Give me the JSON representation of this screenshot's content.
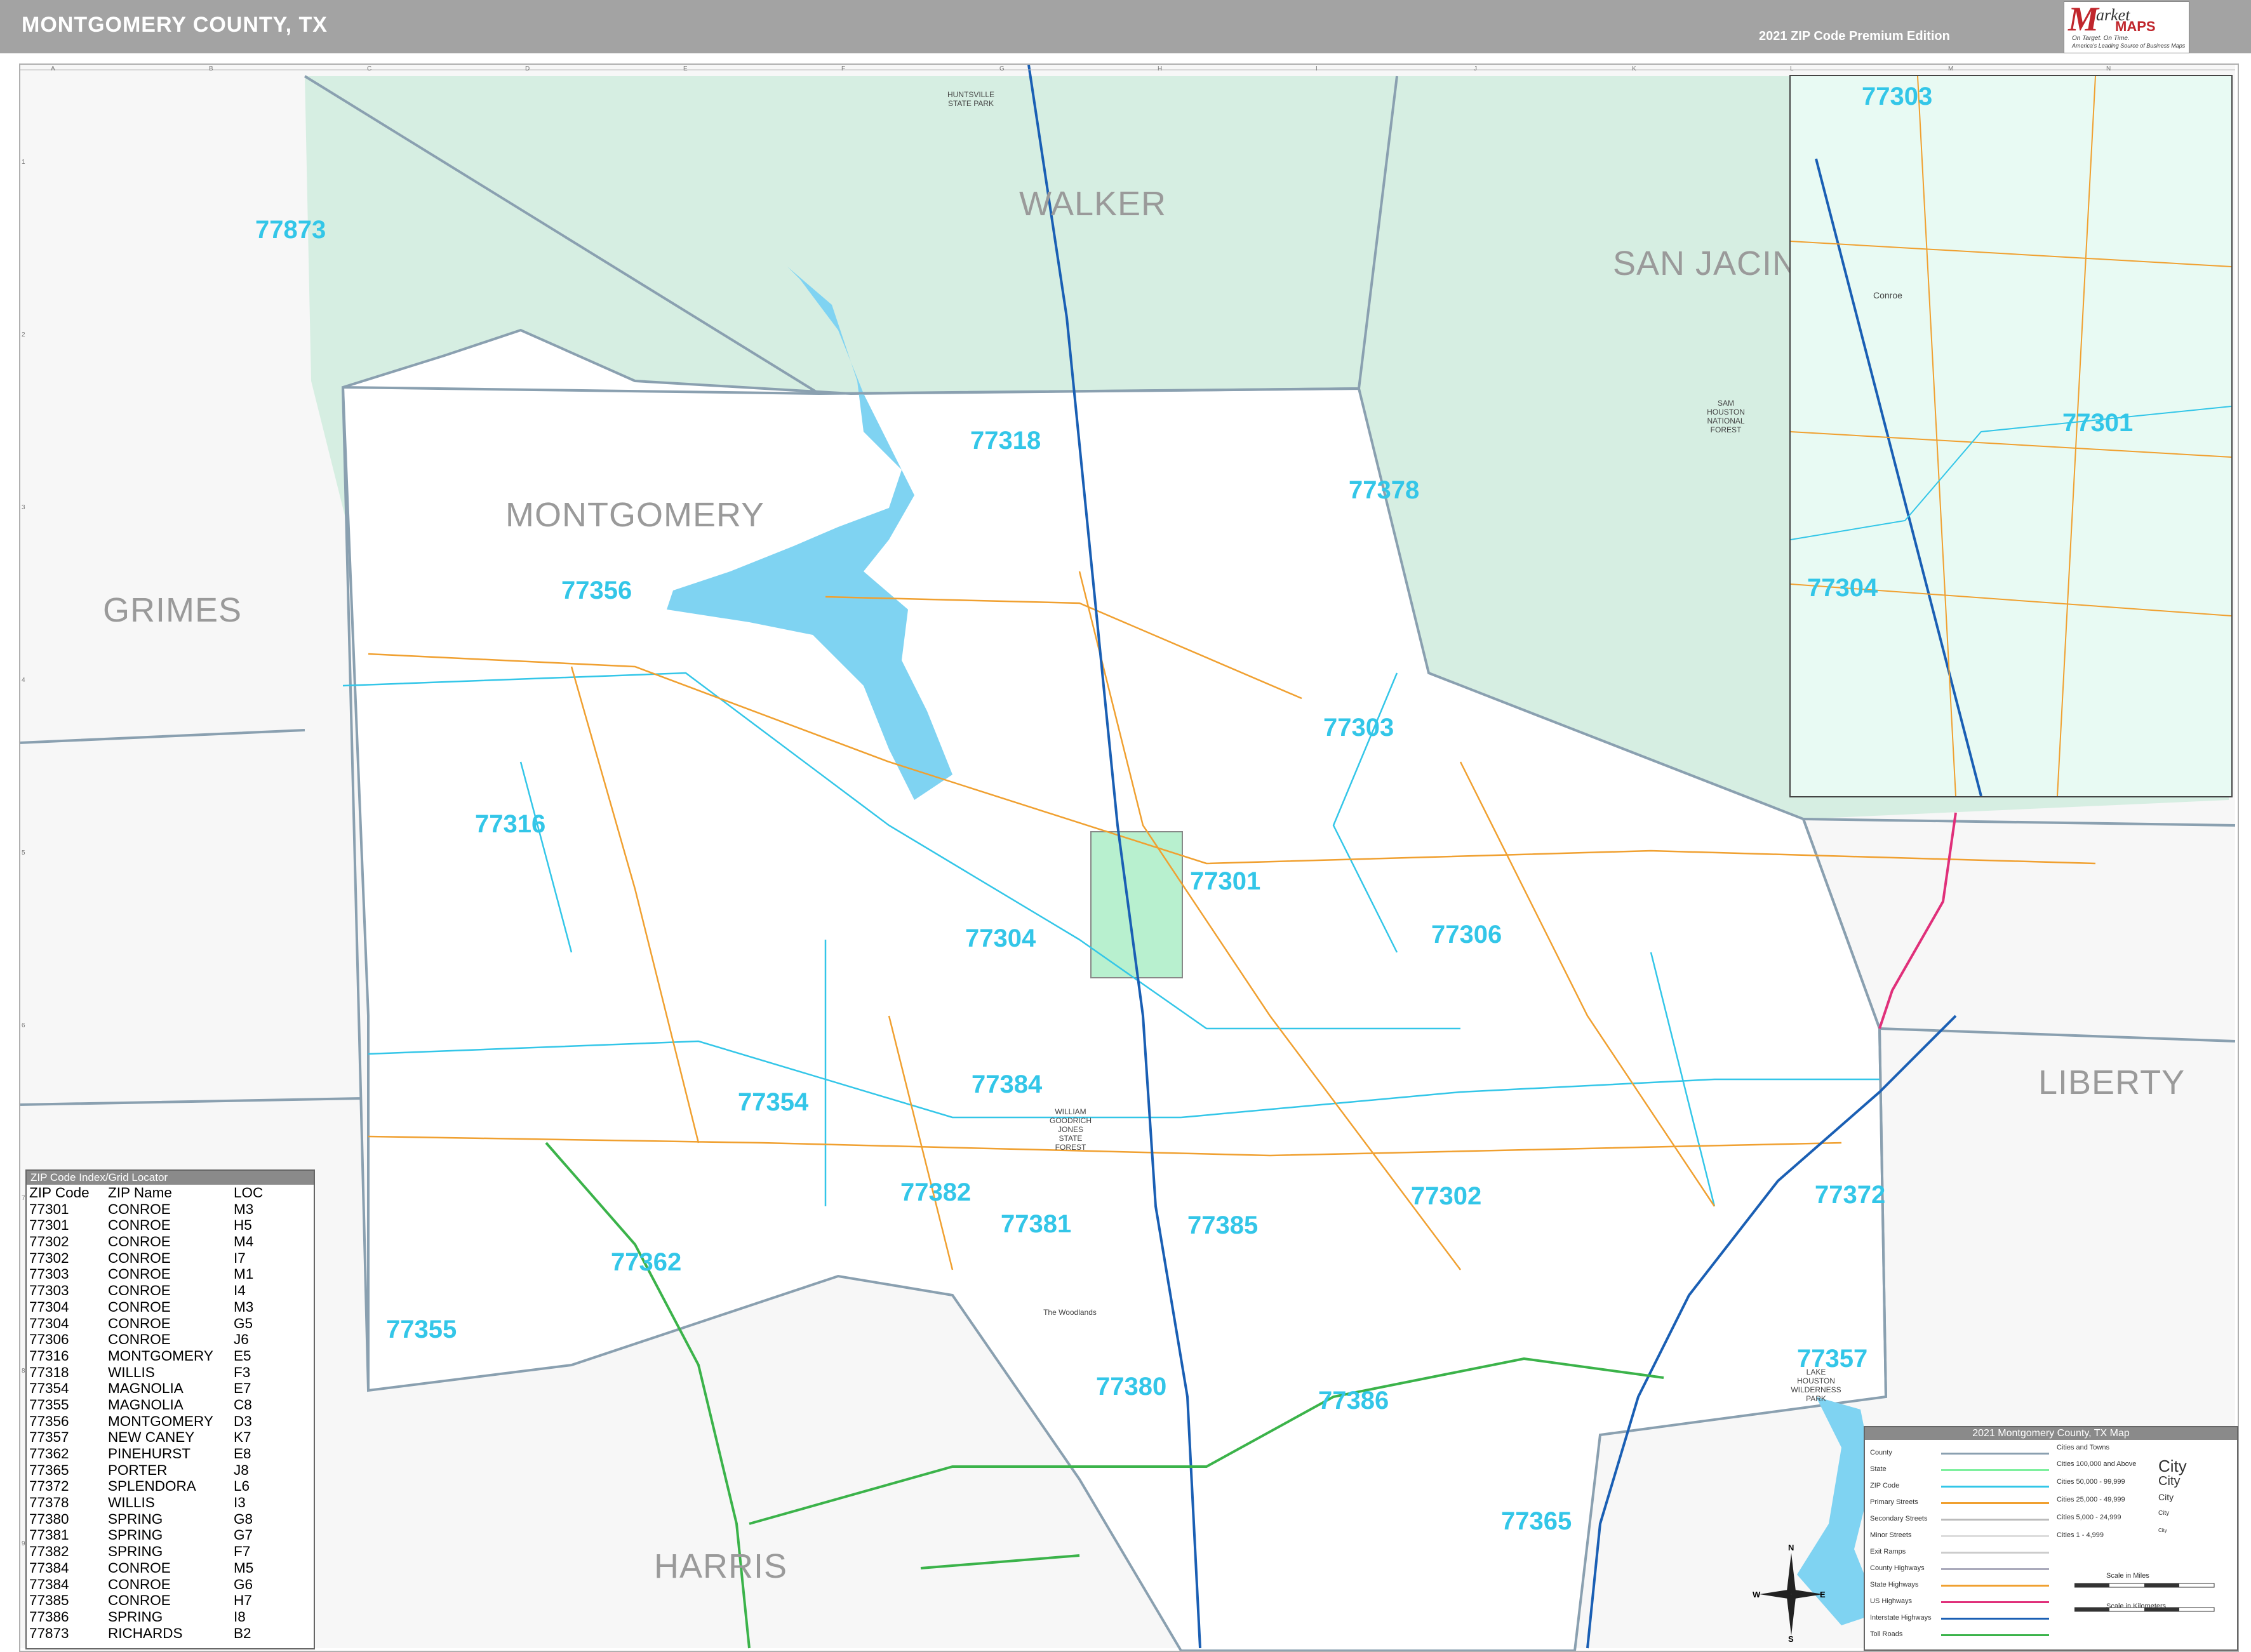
{
  "header": {
    "title": "MONTGOMERY COUNTY, TX",
    "edition": "2021 ZIP Code Premium Edition",
    "logo_word_1": "arket",
    "logo_word_2": "MAPS",
    "logo_tagline_1": "On Target. On Time.",
    "logo_tagline_2": "America's Leading Source of Business Maps"
  },
  "grid_letters": [
    "A",
    "B",
    "C",
    "D",
    "E",
    "F",
    "G",
    "H",
    "I",
    "J",
    "K",
    "L",
    "M",
    "N"
  ],
  "grid_numbers": [
    "1",
    "2",
    "3",
    "4",
    "5",
    "6",
    "7",
    "8",
    "9"
  ],
  "counties": [
    "WALKER",
    "SAN JACINTO",
    "MONTGOMERY",
    "GRIMES",
    "LIBERTY",
    "HARRIS"
  ],
  "zips": [
    "77873",
    "77318",
    "77378",
    "77356",
    "77303",
    "77316",
    "77301",
    "77304",
    "77306",
    "77384",
    "77354",
    "77302",
    "77372",
    "77382",
    "77381",
    "77385",
    "77362",
    "77355",
    "77380",
    "77386",
    "77357",
    "77365"
  ],
  "places": {
    "huntsville_park": "HUNTSVILLE STATE PARK",
    "sam_houston_forest": "SAM HOUSTON NATIONAL FOREST",
    "jones_forest": "WILLIAM GOODRICH JONES STATE FOREST",
    "lake_houston_park": "LAKE HOUSTON WILDERNESS PARK",
    "woodlands": "The Woodlands"
  },
  "inset": {
    "zips": [
      "77303",
      "77301",
      "77304"
    ],
    "city": "Conroe"
  },
  "index": {
    "title": "ZIP Code Index/Grid Locator",
    "headers": [
      "ZIP Code",
      "ZIP Name",
      "LOC"
    ],
    "rows": [
      [
        "77301",
        "CONROE",
        "M3"
      ],
      [
        "77301",
        "CONROE",
        "H5"
      ],
      [
        "77302",
        "CONROE",
        "M4"
      ],
      [
        "77302",
        "CONROE",
        "I7"
      ],
      [
        "77303",
        "CONROE",
        "M1"
      ],
      [
        "77303",
        "CONROE",
        "I4"
      ],
      [
        "77304",
        "CONROE",
        "M3"
      ],
      [
        "77304",
        "CONROE",
        "G5"
      ],
      [
        "77306",
        "CONROE",
        "J6"
      ],
      [
        "77316",
        "MONTGOMERY",
        "E5"
      ],
      [
        "77318",
        "WILLIS",
        "F3"
      ],
      [
        "77354",
        "MAGNOLIA",
        "E7"
      ],
      [
        "77355",
        "MAGNOLIA",
        "C8"
      ],
      [
        "77356",
        "MONTGOMERY",
        "D3"
      ],
      [
        "77357",
        "NEW CANEY",
        "K7"
      ],
      [
        "77362",
        "PINEHURST",
        "E8"
      ],
      [
        "77365",
        "PORTER",
        "J8"
      ],
      [
        "77372",
        "SPLENDORA",
        "L6"
      ],
      [
        "77378",
        "WILLIS",
        "I3"
      ],
      [
        "77380",
        "SPRING",
        "G8"
      ],
      [
        "77381",
        "SPRING",
        "G7"
      ],
      [
        "77382",
        "SPRING",
        "F7"
      ],
      [
        "77384",
        "CONROE",
        "M5"
      ],
      [
        "77384",
        "CONROE",
        "G6"
      ],
      [
        "77385",
        "CONROE",
        "H7"
      ],
      [
        "77386",
        "SPRING",
        "I8"
      ],
      [
        "77873",
        "RICHARDS",
        "B2"
      ]
    ]
  },
  "legend": {
    "title": "2021 Montgomery County, TX Map",
    "items": [
      "County",
      "State",
      "ZIP Code",
      "Primary Streets",
      "Secondary Streets",
      "Minor Streets",
      "Exit Ramps",
      "County Highways",
      "State Highways",
      "US Highways",
      "Interstate Highways",
      "Toll Roads"
    ],
    "city_header": "Cities and Towns",
    "city_classes": [
      {
        "range": "Cities 100,000 and Above",
        "sample": "City"
      },
      {
        "range": "Cities 50,000 - 99,999",
        "sample": "City"
      },
      {
        "range": "Cities 25,000 - 49,999",
        "sample": "City"
      },
      {
        "range": "Cities 5,000 - 24,999",
        "sample": "City"
      },
      {
        "range": "Cities 1 - 4,999",
        "sample": "City"
      }
    ],
    "scale_miles": "Scale in Miles",
    "scale_km": "Scale in Kilometers",
    "compass": [
      "N",
      "S",
      "E",
      "W"
    ]
  },
  "colors": {
    "zip_label": "#33c6e8",
    "forest": "#d6eee2",
    "water": "#7fd3f2",
    "county_line": "#8aa0b0",
    "interstate": "#1a5fb4",
    "us_highway": "#e0307a",
    "state_highway": "#3bb34a",
    "primary_street": "#f0a030"
  }
}
